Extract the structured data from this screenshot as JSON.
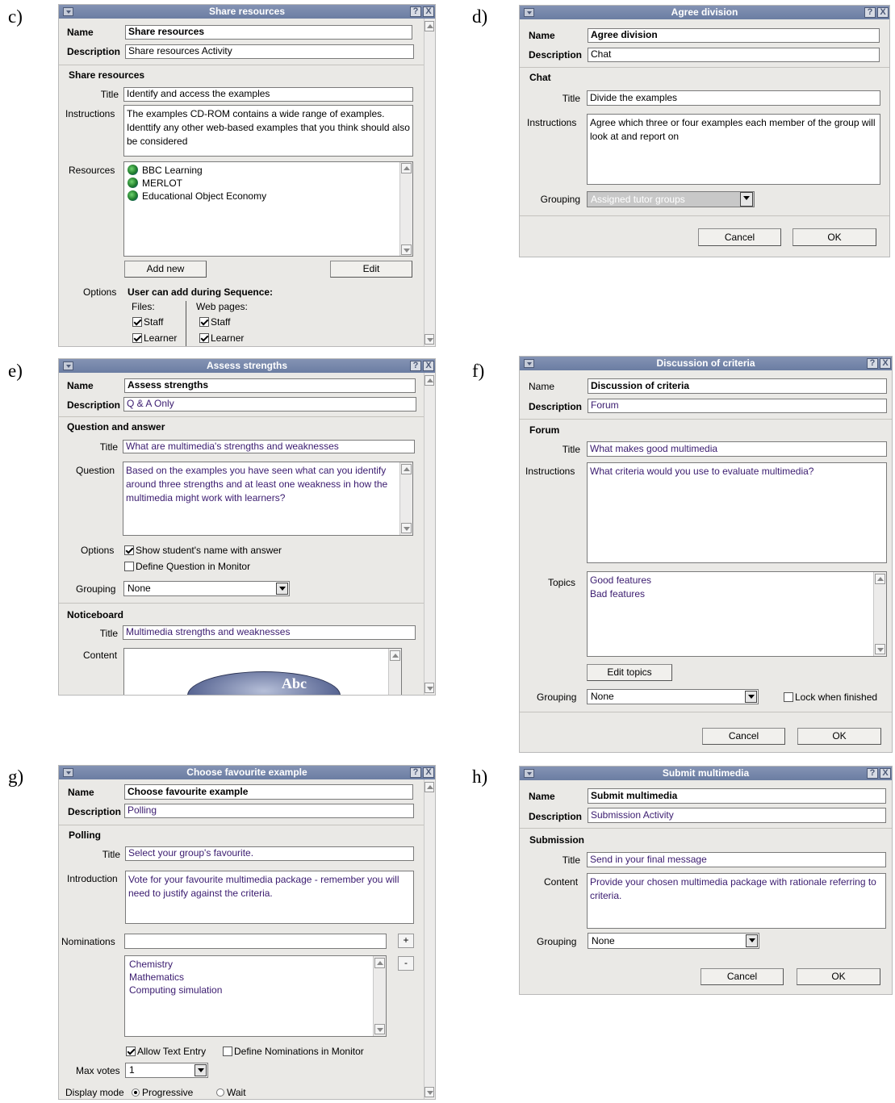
{
  "labels": {
    "c": "c)",
    "d": "d)",
    "e": "e)",
    "f": "f)",
    "g": "g)",
    "h": "h)"
  },
  "common": {
    "help": "?",
    "close": "X",
    "name": "Name",
    "description": "Description",
    "title": "Title",
    "instructions": "Instructions",
    "grouping": "Grouping",
    "options": "Options",
    "content": "Content",
    "cancel": "Cancel",
    "ok": "OK"
  },
  "c": {
    "window_title": "Share resources",
    "name_value": "Share resources",
    "description_value": "Share resources Activity",
    "section": "Share resources",
    "title_value": "Identify and access the examples",
    "instructions_value": "The examples CD-ROM contains a wide range of examples. Identtify any other web-based examples that you think should also be considered",
    "resources_label": "Resources",
    "resources": [
      "BBC Learning",
      "MERLOT",
      "Educational Object Economy"
    ],
    "add_new": "Add new",
    "edit": "Edit",
    "options_heading": "User can add during Sequence:",
    "files": "Files:",
    "web_pages": "Web pages:",
    "staff": "Staff",
    "learner": "Learner"
  },
  "d": {
    "window_title": "Agree division",
    "name_value": "Agree division",
    "description_value": "Chat",
    "section": "Chat",
    "title_value": "Divide the examples",
    "instructions_value": "Agree which three or four examples each member of the group will look at and report on",
    "grouping_value": "Assigned tutor groups"
  },
  "e": {
    "window_title": "Assess strengths",
    "name_value": "Assess strengths",
    "description_value": "Q & A Only",
    "section": "Question and answer",
    "title_value": "What are multimedia's strengths and weaknesses",
    "question_label": "Question",
    "question_value": "Based on the examples you have seen what can you identify around three strengths and at least one weakness in how the multimedia might work with learners?",
    "opt1": "Show student's name with answer",
    "opt2": "Define Question in Monitor",
    "grouping_value": "None",
    "section2": "Noticeboard",
    "title2_value": "Multimedia strengths and weaknesses",
    "logo_text": "Abc"
  },
  "f": {
    "window_title": "Discussion of criteria",
    "name_value": "Discussion of criteria",
    "description_value": "Forum",
    "section": "Forum",
    "title_value": "What makes good multimedia",
    "instructions_value": "What criteria would you use to evaluate multimedia?",
    "topics_label": "Topics",
    "topics": [
      "Good features",
      "Bad features"
    ],
    "edit_topics": "Edit topics",
    "grouping_value": "None",
    "lock": "Lock when finished"
  },
  "g": {
    "window_title": "Choose favourite example",
    "name_value": "Choose favourite example",
    "description_value": "Polling",
    "section": "Polling",
    "title_value": "Select your group's favourite.",
    "intro_label": "Introduction",
    "intro_value": "Vote for your favourite multimedia package - remember you will need to justify against the criteria.",
    "nominations_label": "Nominations",
    "plus": "+",
    "minus": "-",
    "nominations": [
      "Chemistry",
      "Mathematics",
      "Computing simulation"
    ],
    "allow_text": "Allow Text Entry",
    "define_nom": "Define Nominations in Monitor",
    "max_votes_label": "Max votes",
    "max_votes_value": "1",
    "display_mode_label": "Display mode",
    "mode1": "Progressive",
    "mode2": "Wait"
  },
  "h": {
    "window_title": "Submit multimedia",
    "name_value": "Submit multimedia",
    "description_value": "Submission Activity",
    "section": "Submission",
    "title_value": "Send in your final message",
    "content_value": "Provide your chosen multimedia package with rationale referring to criteria.",
    "grouping_value": "None"
  }
}
